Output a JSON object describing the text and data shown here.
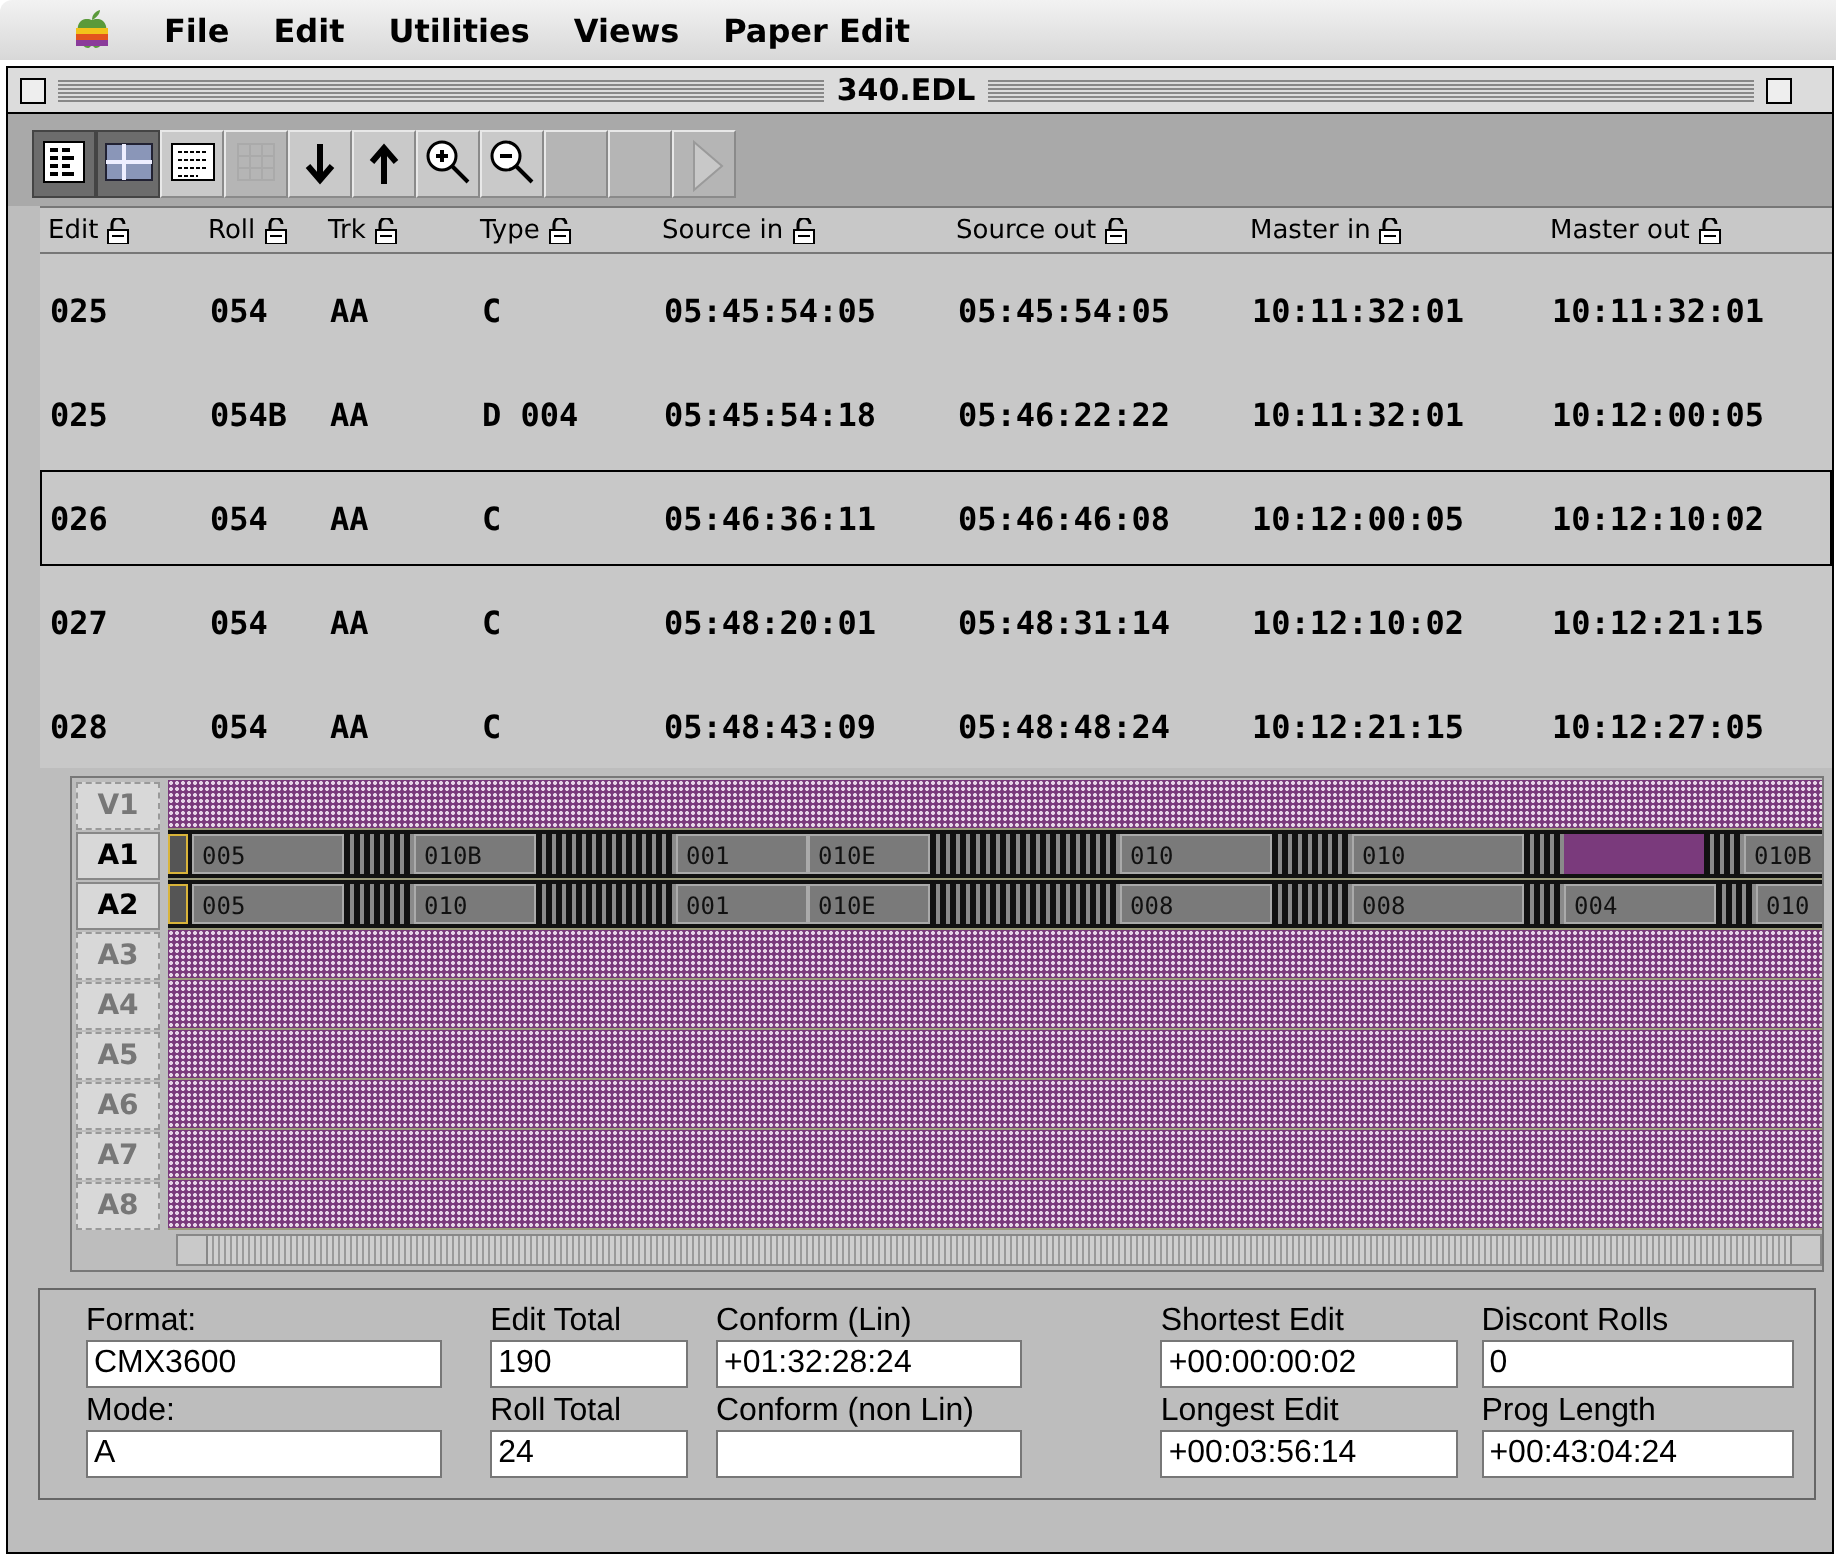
{
  "menu_bar": [
    "File",
    "Edit",
    "Utilities",
    "Views",
    "Paper Edit"
  ],
  "window": {
    "title": "340.EDL"
  },
  "toolbar": [
    {
      "kind": "list-view",
      "selected": true,
      "disabled": false
    },
    {
      "kind": "track-view",
      "selected": true,
      "disabled": false
    },
    {
      "kind": "text-view",
      "selected": false,
      "disabled": false
    },
    {
      "kind": "grid",
      "selected": false,
      "disabled": true
    },
    {
      "kind": "down",
      "selected": false,
      "disabled": false
    },
    {
      "kind": "up",
      "selected": false,
      "disabled": false
    },
    {
      "kind": "zoom-in",
      "selected": false,
      "disabled": false
    },
    {
      "kind": "zoom-out",
      "selected": false,
      "disabled": false
    },
    {
      "kind": "blank",
      "selected": false,
      "disabled": true
    },
    {
      "kind": "blank",
      "selected": false,
      "disabled": true
    },
    {
      "kind": "play",
      "selected": false,
      "disabled": true
    }
  ],
  "table": {
    "columns": [
      "Edit",
      "Roll",
      "Trk",
      "Type",
      "Source in",
      "Source out",
      "Master in",
      "Master out"
    ],
    "rows": [
      {
        "cells": [
          "025",
          "054",
          "AA",
          "C",
          "05:45:54:05",
          "05:45:54:05",
          "10:11:32:01",
          "10:11:32:01"
        ],
        "selected": false
      },
      {
        "cells": [
          "025",
          "054B",
          "AA",
          "D 004",
          "05:45:54:18",
          "05:46:22:22",
          "10:11:32:01",
          "10:12:00:05"
        ],
        "selected": false
      },
      {
        "cells": [
          "026",
          "054",
          "AA",
          "C",
          "05:46:36:11",
          "05:46:46:08",
          "10:12:00:05",
          "10:12:10:02"
        ],
        "selected": true
      },
      {
        "cells": [
          "027",
          "054",
          "AA",
          "C",
          "05:48:20:01",
          "05:48:31:14",
          "10:12:10:02",
          "10:12:21:15"
        ],
        "selected": false
      },
      {
        "cells": [
          "028",
          "054",
          "AA",
          "C",
          "05:48:43:09",
          "05:48:48:24",
          "10:12:21:15",
          "10:12:27:05"
        ],
        "selected": false
      }
    ]
  },
  "timeline": {
    "tracks": [
      {
        "label": "V1",
        "enabled": false
      },
      {
        "label": "A1",
        "enabled": true,
        "clips": [
          {
            "label": "005"
          },
          {
            "label": "010B"
          },
          {
            "label": "001"
          },
          {
            "label": "010E"
          },
          {
            "label": "010"
          },
          {
            "label": "010"
          },
          {
            "kind": "gap"
          },
          {
            "label": "010B"
          }
        ]
      },
      {
        "label": "A2",
        "enabled": true,
        "clips": [
          {
            "label": "005"
          },
          {
            "label": "010"
          },
          {
            "label": "001"
          },
          {
            "label": "010E"
          },
          {
            "label": "008"
          },
          {
            "label": "008"
          },
          {
            "label": "004"
          },
          {
            "label": "010"
          }
        ]
      },
      {
        "label": "A3",
        "enabled": false
      },
      {
        "label": "A4",
        "enabled": false
      },
      {
        "label": "A5",
        "enabled": false
      },
      {
        "label": "A6",
        "enabled": false
      },
      {
        "label": "A7",
        "enabled": false
      },
      {
        "label": "A8",
        "enabled": false
      }
    ]
  },
  "stats": [
    {
      "label": "Format:",
      "value": "CMX3600"
    },
    {
      "label": "Mode:",
      "value": "A"
    },
    {
      "label": "Edit Total",
      "value": "190"
    },
    {
      "label": "Roll Total",
      "value": "24"
    },
    {
      "label": "Conform (Lin)",
      "value": "+01:32:28:24"
    },
    {
      "label": "Conform (non Lin)"
    },
    {
      "label": "Shortest Edit",
      "value": "+00:00:00:02"
    },
    {
      "label": "Longest  Edit",
      "value": "+00:03:56:14"
    },
    {
      "label": "Discont Rolls",
      "value": "0"
    },
    {
      "label": "Prog  Length",
      "value": "+00:43:04:24"
    }
  ]
}
